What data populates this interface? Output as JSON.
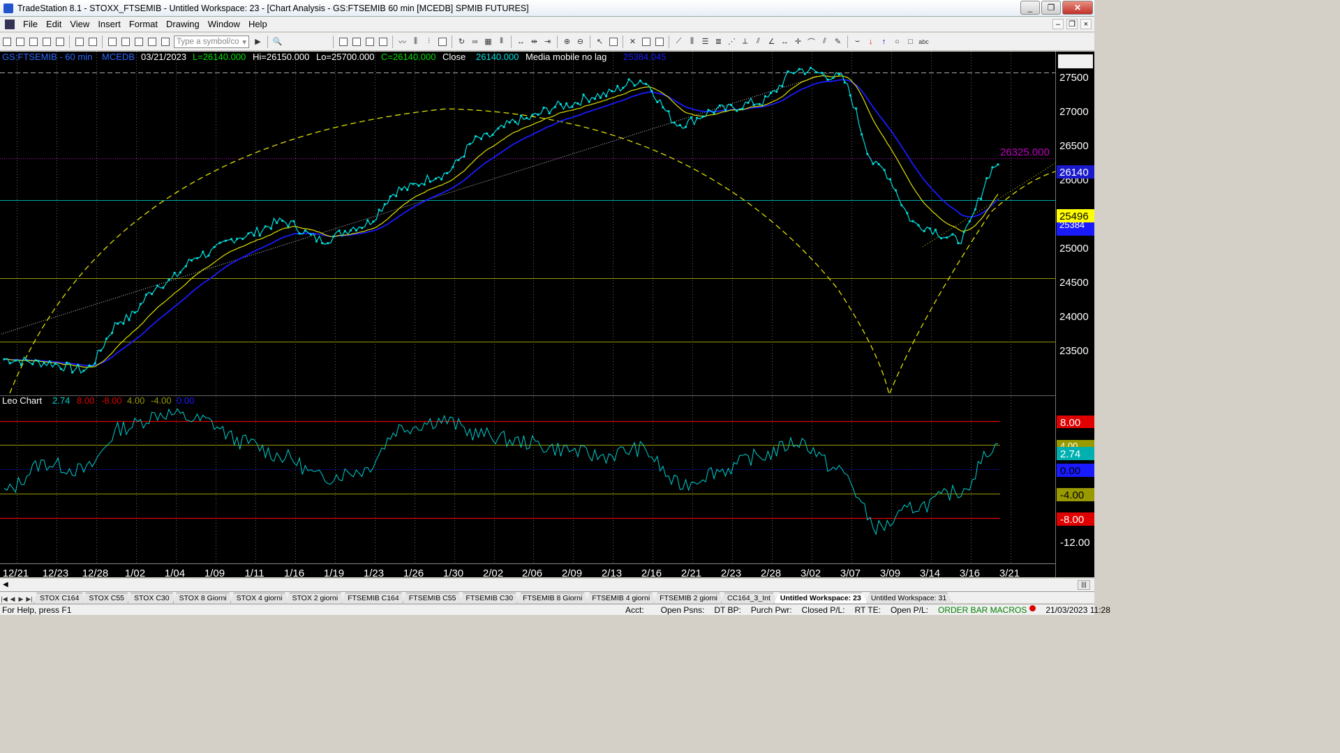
{
  "window": {
    "title": "TradeStation 8.1 - STOXX_FTSEMIB - Untitled Workspace: 23 - [Chart Analysis - GS:FTSEMIB  60 min  [MCEDB] SPMIB FUTURES]",
    "buttons": [
      "_",
      "❐",
      "✕"
    ]
  },
  "menu": {
    "items": [
      "File",
      "Edit",
      "View",
      "Insert",
      "Format",
      "Drawing",
      "Window",
      "Help"
    ]
  },
  "toolbar": {
    "symbol_placeholder": "Type a symbol/co"
  },
  "chart": {
    "header": {
      "symbol": "GS:FTSEMIB - 60 min",
      "source": "MCEDB",
      "date": "03/21/2023",
      "last": "L=26140.000",
      "high": "Hi=26150.000",
      "low": "Lo=25700.000",
      "close_eq": "C=26140.000",
      "close_label": "Close",
      "close_value": "26140.000",
      "indicator": "Media mobile no lag",
      "indicator_value": "25384.045"
    },
    "price_axis": {
      "ticks": [
        "27500",
        "27000",
        "26500",
        "26000",
        "25500",
        "25000",
        "24500",
        "24000",
        "23500"
      ],
      "labels": {
        "level": "26325.000",
        "last": "26140",
        "ma_yellow": "25496",
        "ma_blue": "25384"
      }
    },
    "osc_header": {
      "name": "Leo Chart",
      "v1": "2.74",
      "v2": "8.00",
      "v3": "-8.00",
      "v4": "4.00",
      "v5": "-4.00",
      "v6": "0.00"
    },
    "osc_axis": {
      "labels": {
        "p8": "8.00",
        "p4": "4.00",
        "cur": "2.74",
        "zero": "0.00",
        "m4": "-4.00",
        "m8": "-8.00",
        "m12": "-12.00"
      }
    },
    "date_axis": [
      "12/21",
      "12/23",
      "12/28",
      "1/02",
      "1/04",
      "1/09",
      "1/11",
      "1/16",
      "1/19",
      "1/23",
      "1/26",
      "1/30",
      "2/02",
      "2/06",
      "2/09",
      "2/13",
      "2/16",
      "2/21",
      "2/23",
      "2/28",
      "3/02",
      "3/07",
      "3/09",
      "3/14",
      "3/16",
      "3/21"
    ],
    "colors": {
      "price": "#00e0e0",
      "ma_fast": "#e0e000",
      "ma_slow": "#1a1aff",
      "resistance": "#c000c0",
      "osc": "#00d0d0"
    }
  },
  "tabs": [
    "STOX C164",
    "STOX C55",
    "STOX  C30",
    "STOX  8 Giorni",
    "STOX 4 giorni",
    "STOX  2 giorni",
    "FTSEMIB C164",
    "FTSEMIB C55",
    "FTSEMIB C30",
    "FTSEMIB  8 Giorni",
    "FTSEMIB  4 giorni",
    "FTSEMIB  2 giorni",
    "CC164_3_Int",
    "Untitled Workspace:  23",
    "Untitled Workspace:  31"
  ],
  "status": {
    "help": "For Help, press F1",
    "acct": "Acct:",
    "open_psns": "Open Psns:",
    "dt_bp": "DT BP:",
    "purch_pwr": "Purch Pwr:",
    "closed_pl": "Closed P/L:",
    "rt_te": "RT TE:",
    "open_pl": "Open P/L:",
    "order_bar": "ORDER BAR  MACROS",
    "datetime": "21/03/2023 11:28"
  },
  "chart_data": {
    "type": "line",
    "title": "GS:FTSEMIB - 60 min",
    "x": [
      "12/21",
      "12/23",
      "12/28",
      "1/02",
      "1/04",
      "1/09",
      "1/11",
      "1/16",
      "1/19",
      "1/23",
      "1/26",
      "1/30",
      "2/02",
      "2/06",
      "2/09",
      "2/13",
      "2/16",
      "2/21",
      "2/23",
      "2/28",
      "3/02",
      "3/07",
      "3/09",
      "3/14",
      "3/16",
      "3/21"
    ],
    "series": [
      {
        "values": [
          23450,
          23400,
          23300,
          24000,
          24500,
          24900,
          25150,
          25350,
          25100,
          25300,
          25800,
          26000,
          26500,
          26750,
          26950,
          27100,
          27300,
          26700,
          26900,
          27000,
          27450,
          27350,
          26100,
          25300,
          25100,
          26140
        ]
      }
    ],
    "ylim": [
      22950,
      27700
    ],
    "oscillator": {
      "name": "Leo Chart",
      "values": [
        -4,
        0,
        -1,
        5,
        7,
        6,
        3,
        1,
        -2,
        -1,
        5,
        6,
        4,
        3,
        2,
        1,
        2,
        -3,
        -1,
        1,
        3,
        -1,
        -9,
        -6,
        -4,
        2.74
      ],
      "levels": [
        8,
        4,
        0,
        -4,
        -8
      ],
      "ylim": [
        -14,
        9.5
      ]
    }
  }
}
